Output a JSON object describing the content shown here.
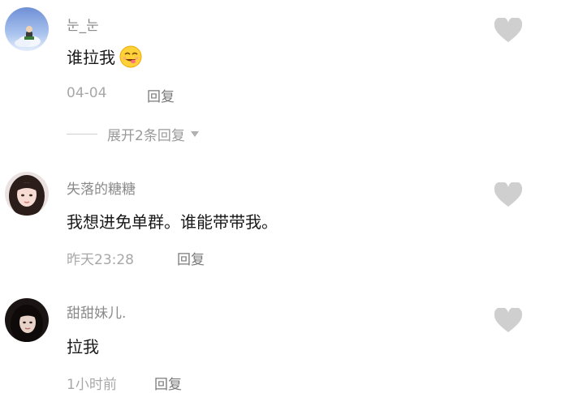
{
  "comments": [
    {
      "author": "눈_눈",
      "text": "谁拉我",
      "emoji": "grinning-tongue-face-icon",
      "time": "04-04",
      "reply_label": "回复",
      "liked": false
    },
    {
      "author": "失落的糖糖",
      "text": "我想进免单群。谁能带带我。",
      "time": "昨天23:28",
      "reply_label": "回复",
      "liked": false
    },
    {
      "author": "甜甜妹儿.",
      "text": "拉我",
      "time": "1小时前",
      "reply_label": "回复",
      "liked": false
    }
  ],
  "expand_replies": {
    "label": "展开2条回复"
  },
  "colors": {
    "author": "#8a8a8a",
    "text": "#1a1a1a",
    "meta": "#a8a8a8",
    "like_icon": "#cfcfcf",
    "background": "#ffffff"
  }
}
